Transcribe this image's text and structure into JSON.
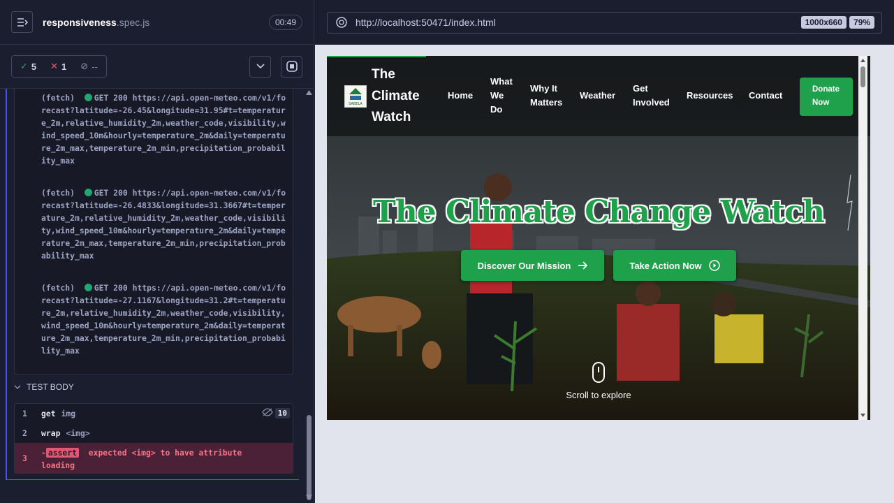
{
  "spec": {
    "name": "responsiveness",
    "ext": ".spec.js",
    "time": "00:49"
  },
  "stats": {
    "passed": "5",
    "failed": "1",
    "pending": "--"
  },
  "logs": [
    {
      "tag": "(fetch)",
      "method": "GET 200",
      "text": "https://api.open-meteo.com/v1/forecast?latitude=-26.45&longitude=31.95#t=temperature_2m,relative_humidity_2m,weather_code,visibility,wind_speed_10m&hourly=temperature_2m&daily=temperature_2m_max,temperature_2m_min,precipitation_probability_max"
    },
    {
      "tag": "(fetch)",
      "method": "GET 200",
      "text": "https://api.open-meteo.com/v1/forecast?latitude=-26.4833&longitude=31.3667#t=temperature_2m,relative_humidity_2m,weather_code,visibility,wind_speed_10m&hourly=temperature_2m&daily=temperature_2m_max,temperature_2m_min,precipitation_probability_max"
    },
    {
      "tag": "(fetch)",
      "method": "GET 200",
      "text": "https://api.open-meteo.com/v1/forecast?latitude=-27.1167&longitude=31.2#t=temperature_2m,relative_humidity_2m,weather_code,visibility,wind_speed_10m&hourly=temperature_2m&daily=temperature_2m_max,temperature_2m_min,precipitation_probability_max"
    }
  ],
  "test_body": {
    "label": "TEST BODY",
    "commands": [
      {
        "num": "1",
        "name": "get",
        "arg": "img",
        "count": "10"
      },
      {
        "num": "2",
        "name": "wrap",
        "arg": "<img>"
      },
      {
        "num": "3",
        "name": "assert",
        "message": "expected <img> to have attribute loading"
      }
    ]
  },
  "browser": {
    "url": "http://localhost:50471/index.html",
    "viewport": "1000x660",
    "zoom": "79%"
  },
  "site": {
    "title": "The Climate Watch",
    "logo_text": "SABELA",
    "nav": [
      "Home",
      "What We Do",
      "Why It Matters",
      "Weather",
      "Get Involved",
      "Resources",
      "Contact"
    ],
    "donate": "Donate Now",
    "hero_title": "The Climate Change Watch",
    "btn_mission": "Discover Our Mission",
    "btn_action": "Take Action Now",
    "scroll_text": "Scroll to explore"
  }
}
